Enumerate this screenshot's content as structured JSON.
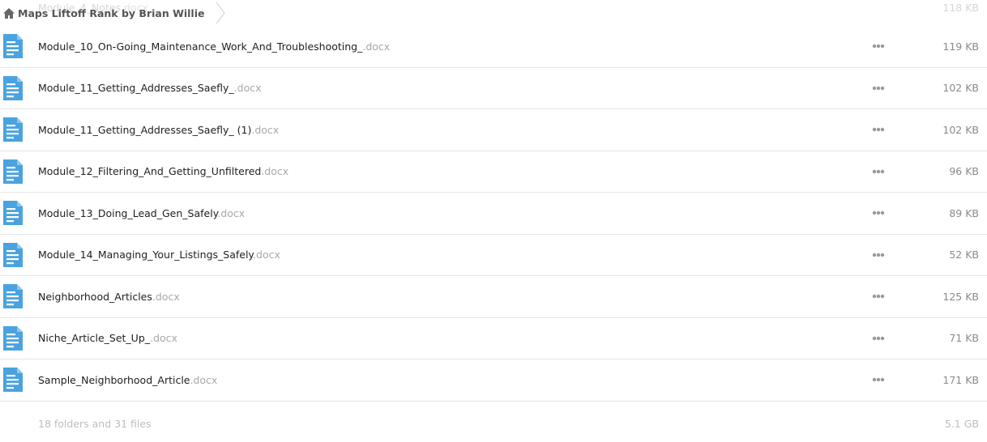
{
  "breadcrumb": {
    "title": "Maps Liftoff Rank by Brian Willie"
  },
  "ghost_row": {
    "name": "Module_4_Notes",
    "ext": ".docx",
    "size": "118 KB"
  },
  "files": [
    {
      "name": "Module_10_On-Going_Maintenance_Work_And_Troubleshooting_",
      "ext": ".docx",
      "size": "119 KB"
    },
    {
      "name": "Module_11_Getting_Addresses_Saefly_",
      "ext": ".docx",
      "size": "102 KB"
    },
    {
      "name": "Module_11_Getting_Addresses_Saefly_ (1)",
      "ext": ".docx",
      "size": "102 KB"
    },
    {
      "name": "Module_12_Filtering_And_Getting_Unfiltered",
      "ext": ".docx",
      "size": "96 KB"
    },
    {
      "name": "Module_13_Doing_Lead_Gen_Safely",
      "ext": ".docx",
      "size": "89 KB"
    },
    {
      "name": "Module_14_Managing_Your_Listings_Safely",
      "ext": ".docx",
      "size": "52 KB"
    },
    {
      "name": "Neighborhood_Articles",
      "ext": ".docx",
      "size": "125 KB"
    },
    {
      "name": "Niche_Article_Set_Up_",
      "ext": ".docx",
      "size": "71 KB"
    },
    {
      "name": "Sample_Neighborhood_Article",
      "ext": ".docx",
      "size": "171 KB"
    }
  ],
  "footer": {
    "summary": "18 folders and 31 files",
    "total": "5.1 GB"
  },
  "colors": {
    "doc_icon": "#4aa3df",
    "more_icon": "#999999"
  }
}
